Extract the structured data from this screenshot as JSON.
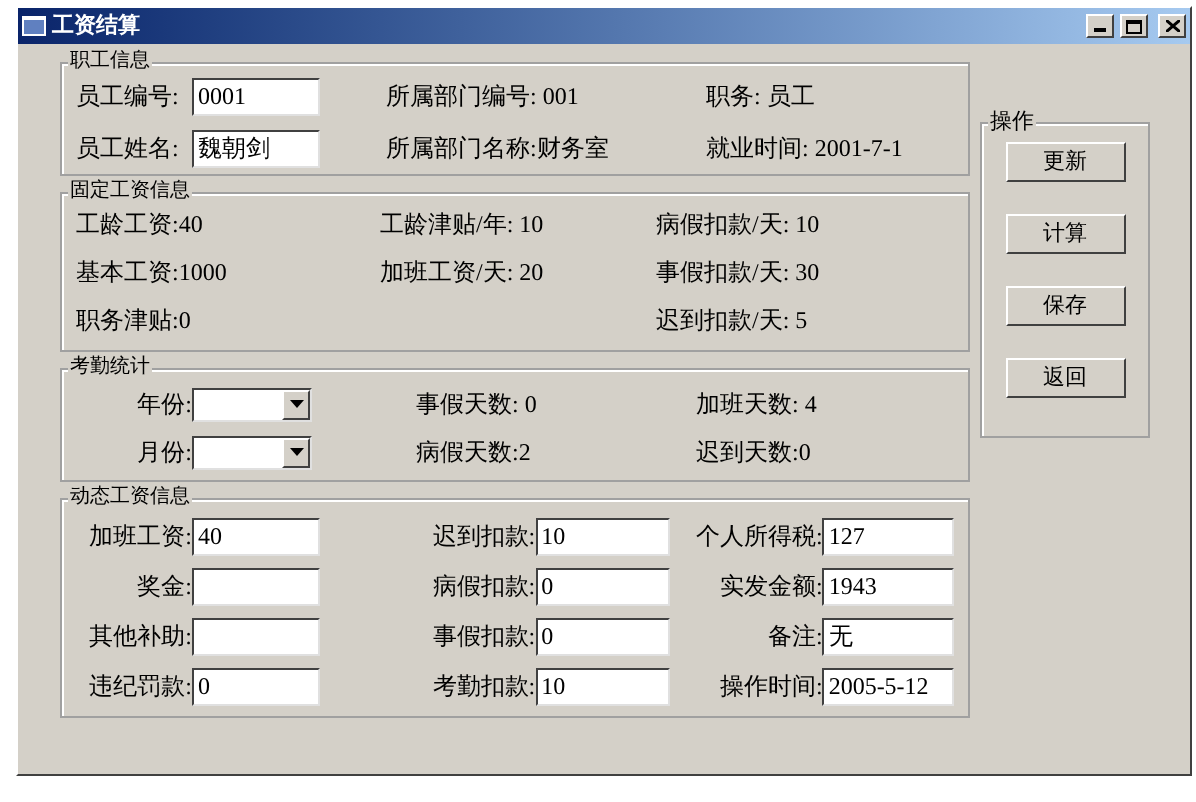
{
  "window": {
    "title": "工资结算"
  },
  "groups": [
    {
      "title": "职工信息",
      "columns": [
        [
          {
            "kind": "field",
            "label": "员工编号:",
            "value": "0001"
          },
          {
            "kind": "field",
            "label": "员工姓名:",
            "value": "魏朝剑"
          }
        ],
        [
          {
            "kind": "text",
            "text": "所属部门编号: 001"
          },
          {
            "kind": "text",
            "text": "所属部门名称:财务室"
          }
        ],
        [
          {
            "kind": "text",
            "text": "职务: 员工"
          },
          {
            "kind": "text",
            "text": "就业时间: 2001-7-1"
          }
        ]
      ]
    },
    {
      "title": "固定工资信息",
      "columns": [
        [
          {
            "kind": "text",
            "text": "工龄工资:40"
          },
          {
            "kind": "text",
            "text": "基本工资:1000"
          },
          {
            "kind": "text",
            "text": "职务津贴:0"
          }
        ],
        [
          {
            "kind": "text",
            "text": "工龄津贴/年: 10"
          },
          {
            "kind": "text",
            "text": "加班工资/天: 20"
          }
        ],
        [
          {
            "kind": "text",
            "text": "病假扣款/天: 10"
          },
          {
            "kind": "text",
            "text": "事假扣款/天: 30"
          },
          {
            "kind": "text",
            "text": "迟到扣款/天: 5"
          }
        ]
      ]
    },
    {
      "title": "考勤统计",
      "columns": [
        [
          {
            "kind": "combo",
            "label": "年份:"
          },
          {
            "kind": "combo",
            "label": "月份:"
          }
        ],
        [
          {
            "kind": "text",
            "text": "事假天数: 0"
          },
          {
            "kind": "text",
            "text": "病假天数:2"
          }
        ],
        [
          {
            "kind": "text",
            "text": "加班天数: 4"
          },
          {
            "kind": "text",
            "text": "迟到天数:0"
          }
        ]
      ]
    },
    {
      "title": "动态工资信息",
      "columns": [
        [
          {
            "kind": "field",
            "label": "加班工资:",
            "value": "40"
          },
          {
            "kind": "field",
            "label": "奖金:"
          },
          {
            "kind": "field",
            "label": "其他补助:"
          },
          {
            "kind": "field",
            "label": "违纪罚款:",
            "value": "0"
          }
        ],
        [
          {
            "kind": "field",
            "label": "迟到扣款:",
            "value": "10"
          },
          {
            "kind": "field",
            "label": "病假扣款:",
            "value": "0"
          },
          {
            "kind": "field",
            "label": "事假扣款:",
            "value": "0"
          },
          {
            "kind": "field",
            "label": "考勤扣款:",
            "value": "10"
          }
        ],
        [
          {
            "kind": "field",
            "label": "个人所得税:",
            "value": "127"
          },
          {
            "kind": "field",
            "label": "实发金额:",
            "value": "1943"
          },
          {
            "kind": "field",
            "label": "备注:",
            "value": "无"
          },
          {
            "kind": "field",
            "label": "操作时间:",
            "value": "2005-5-12"
          }
        ]
      ]
    }
  ],
  "operations": {
    "title": "操作",
    "buttons": [
      "更新",
      "计算",
      "保存",
      "返回"
    ]
  }
}
